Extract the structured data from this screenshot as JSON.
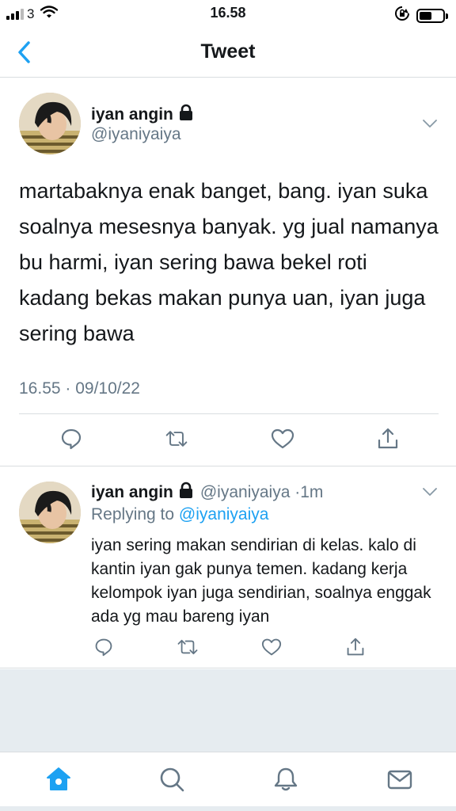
{
  "status_bar": {
    "carrier": "3",
    "time": "16.58"
  },
  "nav": {
    "title": "Tweet"
  },
  "main_tweet": {
    "display_name": "iyan angin",
    "handle": "@iyaniyaiya",
    "text": "martabaknya enak banget, bang. iyan suka soalnya mesesnya banyak. yg jual namanya bu harmi, iyan sering bawa bekel roti kadang bekas makan punya uan, iyan juga sering bawa",
    "timestamp": "16.55 · 09/10/22"
  },
  "reply_tweet": {
    "display_name": "iyan angin",
    "handle": "@iyaniyaiya",
    "time_ago": "1m",
    "replying_prefix": "Replying to",
    "replying_to": "@iyaniyaiya",
    "text": "iyan sering makan sendirian di kelas. kalo di kantin iyan gak punya temen. kadang kerja kelompok iyan juga sendirian, soalnya enggak ada yg mau bareng iyan"
  },
  "colors": {
    "accent": "#1da1f2",
    "secondary_text": "#657786",
    "primary_text": "#14171a",
    "background_gray": "#e6ecf0"
  },
  "icons": [
    "back-chevron-icon",
    "lock-icon",
    "chevron-down-icon",
    "reply-icon",
    "retweet-icon",
    "like-icon",
    "share-icon",
    "home-icon",
    "search-icon",
    "notifications-icon",
    "messages-icon"
  ]
}
